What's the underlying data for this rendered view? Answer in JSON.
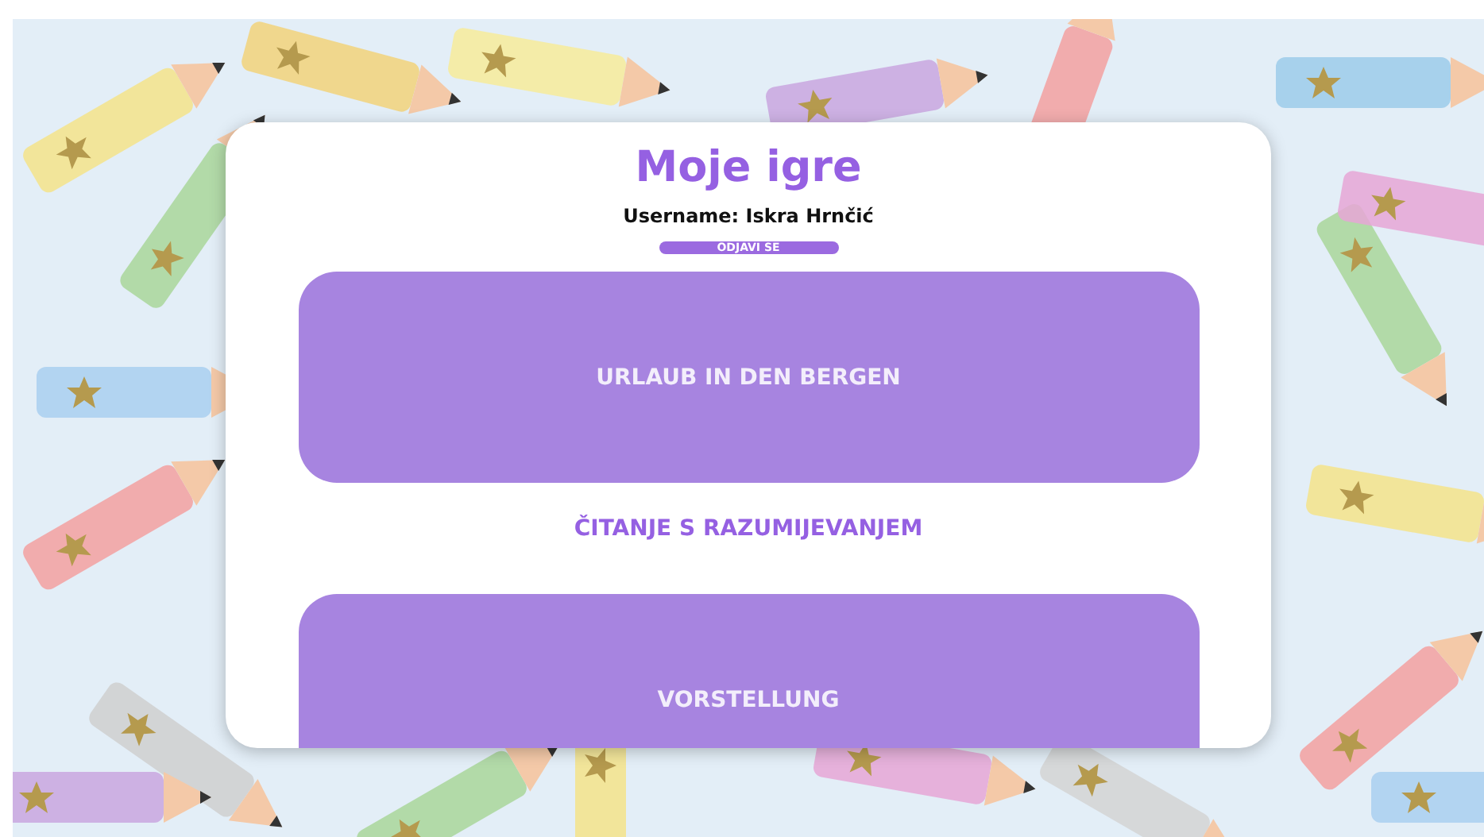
{
  "header": {
    "title": "Moje igre",
    "username": "Username: Iskra Hrnčić",
    "logout_button": "ODJAVI SE"
  },
  "games": [
    {
      "kind": "card",
      "label": "URLAUB IN DEN BERGEN"
    },
    {
      "kind": "plain",
      "label": "ČITANJE S RAZUMIJEVANJEM"
    },
    {
      "kind": "card",
      "label": "VORSTELLUNG"
    }
  ]
}
